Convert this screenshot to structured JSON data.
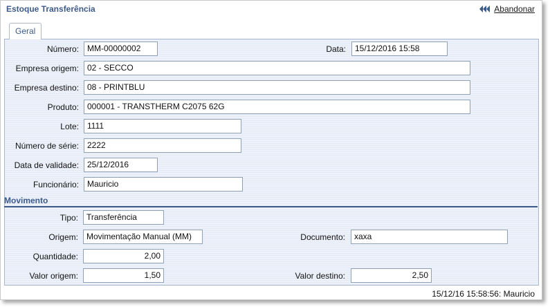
{
  "header": {
    "title": "Estoque Transferência",
    "abandon_label": "Abandonar",
    "abandon_icon": "double-rewind-icon"
  },
  "tabs": [
    {
      "label": "Geral",
      "active": true
    }
  ],
  "form": {
    "numero": {
      "label": "Número:",
      "value": "MM-00000002"
    },
    "data": {
      "label": "Data:",
      "value": "15/12/2016 15:58"
    },
    "empresa_origem": {
      "label": "Empresa origem:",
      "value": "02 - SECCO"
    },
    "empresa_destino": {
      "label": "Empresa destino:",
      "value": "08 - PRINTBLU"
    },
    "produto": {
      "label": "Produto:",
      "value": "000001 - TRANSTHERM C2075 62G"
    },
    "lote": {
      "label": "Lote:",
      "value": "1111"
    },
    "numero_serie": {
      "label": "Número de série:",
      "value": "2222"
    },
    "data_validade": {
      "label": "Data de validade:",
      "value": "25/12/2016"
    },
    "funcionario": {
      "label": "Funcionário:",
      "value": "Mauricio"
    }
  },
  "movimento": {
    "title": "Movimento",
    "tipo": {
      "label": "Tipo:",
      "value": "Transferência"
    },
    "origem": {
      "label": "Origem:",
      "value": "Movimentação Manual (MM)"
    },
    "documento": {
      "label": "Documento:",
      "value": "xaxa"
    },
    "quantidade": {
      "label": "Quantidade:",
      "value": "2,00"
    },
    "valor_origem": {
      "label": "Valor origem:",
      "value": "1,50"
    },
    "valor_destino": {
      "label": "Valor destino:",
      "value": "2,50"
    }
  },
  "footer": {
    "status": "15/12/16 15:58:56: Mauricio"
  },
  "colors": {
    "accent": "#3c5a8a",
    "panel_bg": "#e8eef8",
    "required_marker": "#3f5f8f"
  }
}
